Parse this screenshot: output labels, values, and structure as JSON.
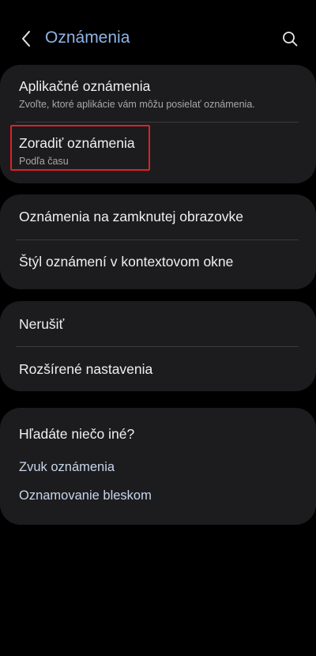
{
  "header": {
    "title": "Oznámenia"
  },
  "groups": [
    {
      "items": [
        {
          "title": "Aplikačné oznámenia",
          "subtitle": "Zvoľte, ktoré aplikácie vám môžu posielať oznámenia."
        },
        {
          "title": "Zoradiť oznámenia",
          "subtitle": "Podľa času"
        }
      ]
    },
    {
      "items": [
        {
          "title": "Oznámenia na zamknutej obrazovke"
        },
        {
          "title": "Štýl oznámení v kontextovom okne"
        }
      ]
    },
    {
      "items": [
        {
          "title": "Nerušiť"
        },
        {
          "title": "Rozšírené nastavenia"
        }
      ]
    }
  ],
  "suggestions": {
    "heading": "Hľadáte niečo iné?",
    "links": [
      "Zvuk oznámenia",
      "Oznamovanie bleskom"
    ]
  },
  "colors": {
    "accent_title": "#8fb4e6",
    "highlight_border": "#e0202a",
    "card_bg": "#1c1c1e"
  },
  "icons": {
    "back": "chevron-left-icon",
    "search": "search-icon"
  }
}
